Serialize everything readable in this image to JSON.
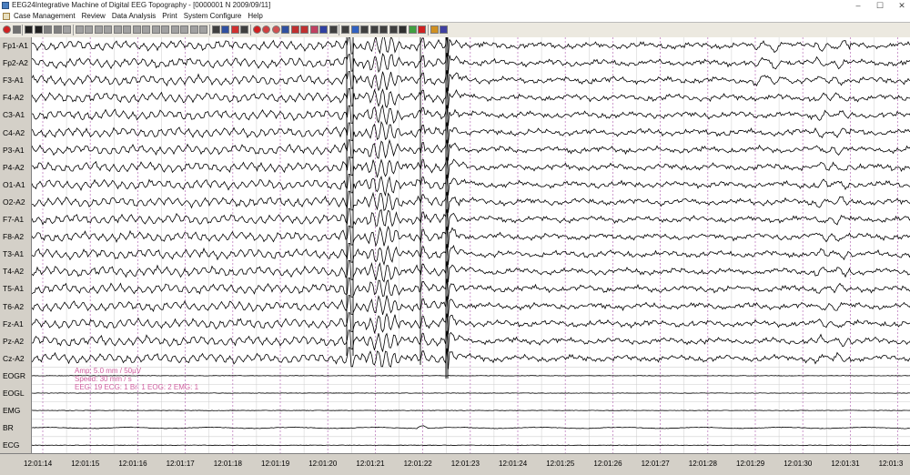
{
  "window": {
    "title": "EEG24Integrative Machine of Digital EEG Topography - [0000001 N 2009/09/11]"
  },
  "menu": [
    {
      "label": "Case Management"
    },
    {
      "label": "Review"
    },
    {
      "label": "Data Analysis"
    },
    {
      "label": "Print"
    },
    {
      "label": "System Configure"
    },
    {
      "label": "Help"
    }
  ],
  "channels": [
    {
      "label": "Fp1-A1",
      "type": "eeg"
    },
    {
      "label": "Fp2-A2",
      "type": "eeg"
    },
    {
      "label": "F3-A1",
      "type": "eeg"
    },
    {
      "label": "F4-A2",
      "type": "eeg"
    },
    {
      "label": "C3-A1",
      "type": "eeg"
    },
    {
      "label": "C4-A2",
      "type": "eeg"
    },
    {
      "label": "P3-A1",
      "type": "eeg"
    },
    {
      "label": "P4-A2",
      "type": "eeg"
    },
    {
      "label": "O1-A1",
      "type": "eeg"
    },
    {
      "label": "O2-A2",
      "type": "eeg"
    },
    {
      "label": "F7-A1",
      "type": "eeg"
    },
    {
      "label": "F8-A2",
      "type": "eeg"
    },
    {
      "label": "T3-A1",
      "type": "eeg"
    },
    {
      "label": "T4-A2",
      "type": "eeg"
    },
    {
      "label": "T5-A1",
      "type": "eeg"
    },
    {
      "label": "T6-A2",
      "type": "eeg"
    },
    {
      "label": "Fz-A1",
      "type": "eeg"
    },
    {
      "label": "Pz-A2",
      "type": "eeg"
    },
    {
      "label": "Cz-A2",
      "type": "eeg"
    },
    {
      "label": "EOGR",
      "type": "flat"
    },
    {
      "label": "EOGL",
      "type": "flat"
    },
    {
      "label": "EMG",
      "type": "flat"
    },
    {
      "label": "BR",
      "type": "br"
    },
    {
      "label": "ECG",
      "type": "flat"
    }
  ],
  "info": {
    "amp": "Amp: 5.0 mm / 50µV",
    "speed": "Speed: 30 mm / s",
    "counts": "EEG: 19  ECG: 1  Br: 1  EOG: 2  EMG: 1"
  },
  "time_labels": [
    "12:01:14",
    "12:01:15",
    "12:01:16",
    "12:01:17",
    "12:01:18",
    "12:01:19",
    "12:01:20",
    "12:01:21",
    "12:01:22",
    "12:01:23",
    "12:01:24",
    "12:01:25",
    "12:01:26",
    "12:01:27",
    "12:01:28",
    "12:01:29",
    "12:01:30",
    "12:01:31",
    "12:01:3"
  ],
  "colors": {
    "trace": "#000000",
    "grid_dashed": "#c080c0",
    "info_text": "#d060a0",
    "background": "#ffffff"
  }
}
